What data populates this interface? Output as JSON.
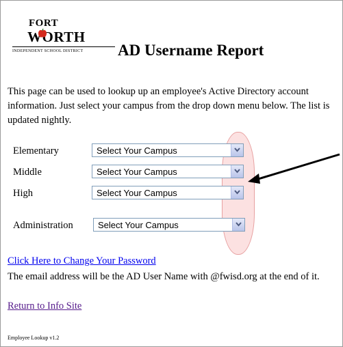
{
  "logo": {
    "line1": "FORT",
    "line2": "WORTH",
    "district": "INDEPENDENT SCHOOL DISTRICT"
  },
  "page": {
    "title": "AD Username Report",
    "intro": "This page can be used to lookup up an employee's Active Directory account information.  Just select your campus from the drop down menu below.  The list is updated nightly."
  },
  "form": {
    "rows": [
      {
        "label": "Elementary",
        "selected": "Select Your Campus"
      },
      {
        "label": "Middle",
        "selected": "Select Your Campus"
      },
      {
        "label": "High",
        "selected": "Select Your Campus"
      },
      {
        "label": "Administration",
        "selected": "Select Your Campus"
      }
    ]
  },
  "footer": {
    "change_password_link": "Click Here to Change Your Password",
    "email_note": "The email address will be the AD User Name with @fwisd.org at the end of it.",
    "info_site_link": "Return to Info Site",
    "version": "Employee Lookup v1.2"
  },
  "colors": {
    "link": "#0000ee",
    "visited_link": "#551a8b",
    "highlight": "#f5aaaa",
    "arrow": "#000000"
  }
}
